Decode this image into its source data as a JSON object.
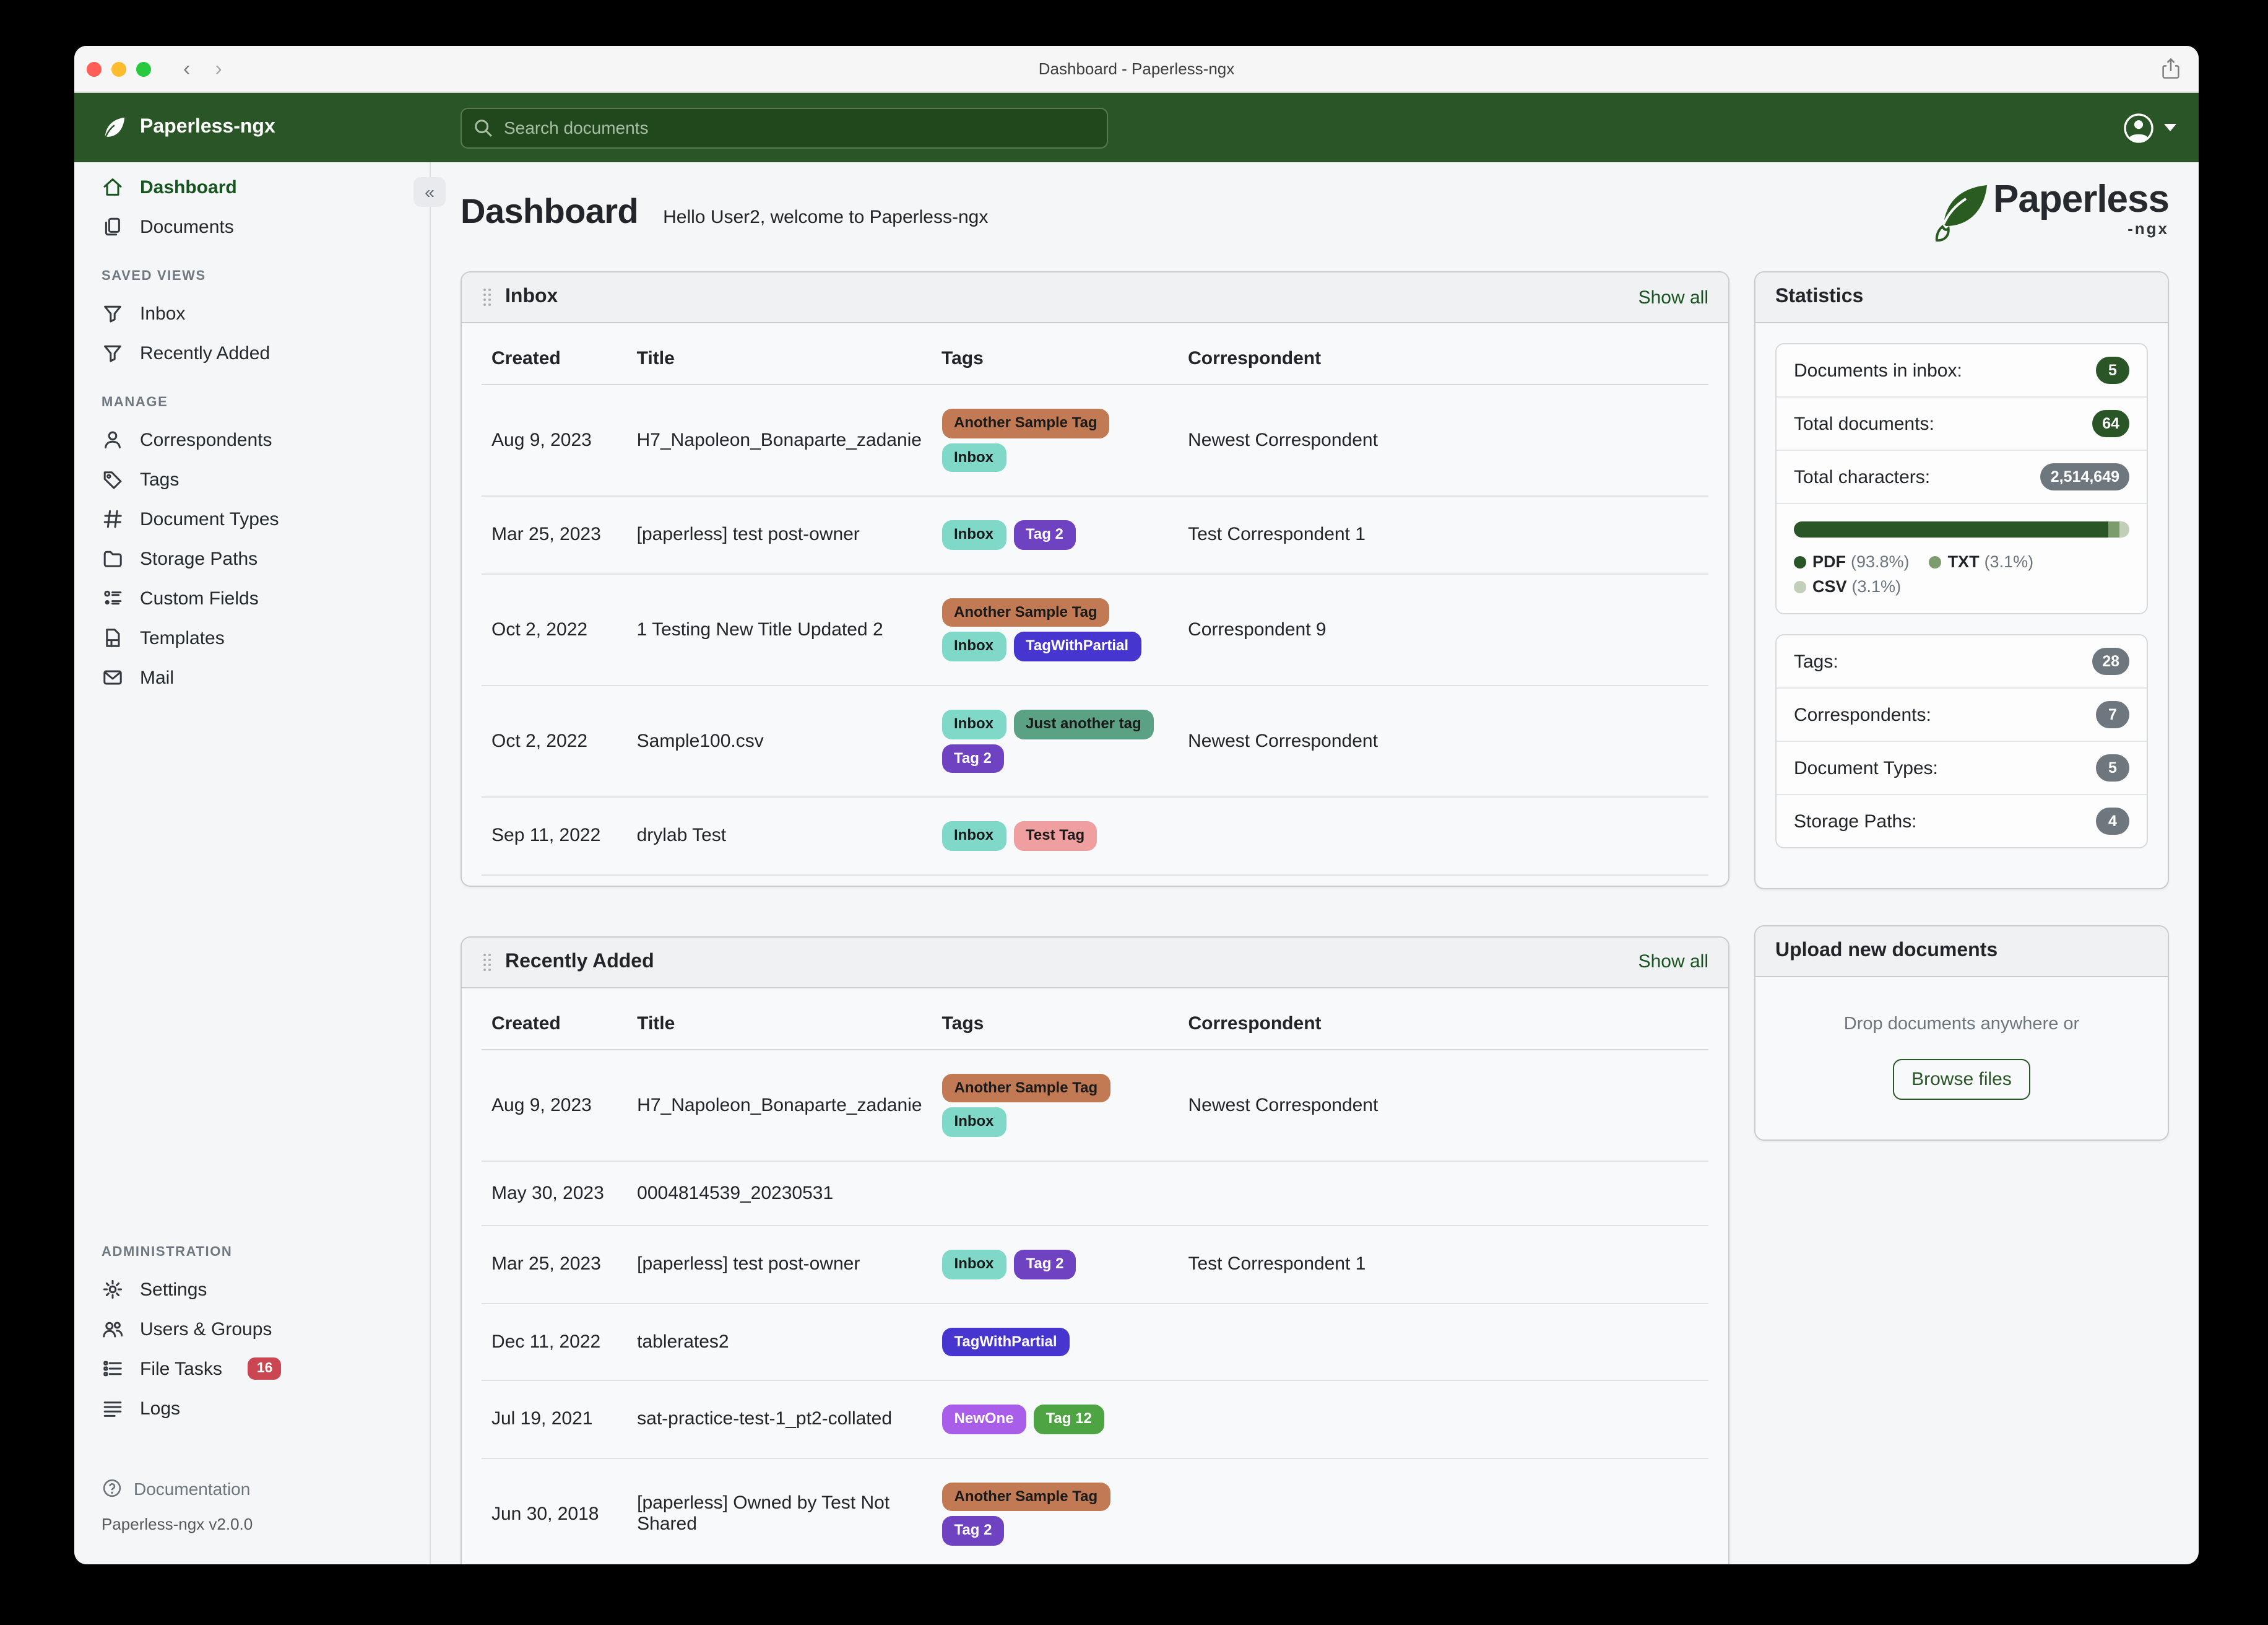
{
  "window": {
    "title": "Dashboard - Paperless-ngx"
  },
  "navbar": {
    "brand": "Paperless-ngx",
    "search_placeholder": "Search documents"
  },
  "sidebar": {
    "items": [
      {
        "label": "Dashboard",
        "icon": "home",
        "active": true
      },
      {
        "label": "Documents",
        "icon": "documents",
        "active": false
      }
    ],
    "sections": [
      {
        "title": "SAVED VIEWS",
        "items": [
          {
            "label": "Inbox",
            "icon": "filter"
          },
          {
            "label": "Recently Added",
            "icon": "filter"
          }
        ]
      },
      {
        "title": "MANAGE",
        "items": [
          {
            "label": "Correspondents",
            "icon": "person"
          },
          {
            "label": "Tags",
            "icon": "tag"
          },
          {
            "label": "Document Types",
            "icon": "hash"
          },
          {
            "label": "Storage Paths",
            "icon": "folder"
          },
          {
            "label": "Custom Fields",
            "icon": "fields"
          },
          {
            "label": "Templates",
            "icon": "template"
          },
          {
            "label": "Mail",
            "icon": "mail"
          }
        ]
      },
      {
        "title": "ADMINISTRATION",
        "items": [
          {
            "label": "Settings",
            "icon": "gear"
          },
          {
            "label": "Users & Groups",
            "icon": "users"
          },
          {
            "label": "File Tasks",
            "icon": "tasks",
            "badge": "16"
          },
          {
            "label": "Logs",
            "icon": "logs"
          }
        ]
      }
    ],
    "footer": {
      "documentation": "Documentation",
      "version": "Paperless-ngx v2.0.0"
    }
  },
  "page": {
    "heading": "Dashboard",
    "subtitle": "Hello User2, welcome to Paperless-ngx"
  },
  "logo": {
    "name": "Paperless",
    "suffix": "-ngx"
  },
  "tag_palette": {
    "Another Sample Tag": {
      "bg": "#c17a53",
      "fg": "#1a1a1a"
    },
    "Inbox": {
      "bg": "#7fd8c8",
      "fg": "#1a1a1a"
    },
    "Tag 2": {
      "bg": "#6f42c1",
      "fg": "#ffffff"
    },
    "TagWithPartial": {
      "bg": "#4636cf",
      "fg": "#ffffff"
    },
    "Just another tag": {
      "bg": "#5ba184",
      "fg": "#1a1a1a"
    },
    "Test Tag": {
      "bg": "#ef9f9f",
      "fg": "#1a1a1a"
    },
    "NewOne": {
      "bg": "#a95eea",
      "fg": "#ffffff"
    },
    "Tag 12": {
      "bg": "#4ea342",
      "fg": "#ffffff"
    }
  },
  "cards": [
    {
      "title": "Inbox",
      "show_all": "Show all",
      "columns": [
        "Created",
        "Title",
        "Tags",
        "Correspondent"
      ],
      "rows": [
        {
          "created": "Aug 9, 2023",
          "title": "H7_Napoleon_Bonaparte_zadanie",
          "tags": [
            "Another Sample Tag",
            "Inbox"
          ],
          "correspondent": "Newest Correspondent"
        },
        {
          "created": "Mar 25, 2023",
          "title": "[paperless] test post-owner",
          "tags": [
            "Inbox",
            "Tag 2"
          ],
          "correspondent": "Test Correspondent 1"
        },
        {
          "created": "Oct 2, 2022",
          "title": "1 Testing New Title Updated 2",
          "tags": [
            "Another Sample Tag",
            "Inbox",
            "TagWithPartial"
          ],
          "correspondent": "Correspondent 9"
        },
        {
          "created": "Oct 2, 2022",
          "title": "Sample100.csv",
          "tags": [
            "Inbox",
            "Just another tag",
            "Tag 2"
          ],
          "correspondent": "Newest Correspondent"
        },
        {
          "created": "Sep 11, 2022",
          "title": "drylab Test",
          "tags": [
            "Inbox",
            "Test Tag"
          ],
          "correspondent": ""
        }
      ]
    },
    {
      "title": "Recently Added",
      "show_all": "Show all",
      "columns": [
        "Created",
        "Title",
        "Tags",
        "Correspondent"
      ],
      "rows": [
        {
          "created": "Aug 9, 2023",
          "title": "H7_Napoleon_Bonaparte_zadanie",
          "tags": [
            "Another Sample Tag",
            "Inbox"
          ],
          "correspondent": "Newest Correspondent"
        },
        {
          "created": "May 30, 2023",
          "title": "0004814539_20230531",
          "tags": [],
          "correspondent": ""
        },
        {
          "created": "Mar 25, 2023",
          "title": "[paperless] test post-owner",
          "tags": [
            "Inbox",
            "Tag 2"
          ],
          "correspondent": "Test Correspondent 1"
        },
        {
          "created": "Dec 11, 2022",
          "title": "tablerates2",
          "tags": [
            "TagWithPartial"
          ],
          "correspondent": ""
        },
        {
          "created": "Jul 19, 2021",
          "title": "sat-practice-test-1_pt2-collated",
          "tags": [
            "NewOne",
            "Tag 12"
          ],
          "correspondent": ""
        },
        {
          "created": "Jun 30, 2018",
          "title": "[paperless] Owned by Test Not Shared",
          "tags": [
            "Another Sample Tag",
            "Tag 2"
          ],
          "correspondent": ""
        }
      ]
    }
  ],
  "statistics": {
    "title": "Statistics",
    "rows": [
      {
        "label": "Documents in inbox:",
        "value": "5",
        "style": "green"
      },
      {
        "label": "Total documents:",
        "value": "64",
        "style": "green"
      },
      {
        "label": "Total characters:",
        "value": "2,514,649",
        "style": "gray"
      }
    ],
    "file_type_chart": {
      "type": "bar",
      "segments": [
        {
          "label": "PDF",
          "pct": 93.8,
          "pct_text": "(93.8%)",
          "color": "#2a5527"
        },
        {
          "label": "TXT",
          "pct": 3.1,
          "pct_text": "(3.1%)",
          "color": "#7d9c6e"
        },
        {
          "label": "CSV",
          "pct": 3.1,
          "pct_text": "(3.1%)",
          "color": "#c2cfb8"
        }
      ]
    },
    "counts": [
      {
        "label": "Tags:",
        "value": "28",
        "style": "gray"
      },
      {
        "label": "Correspondents:",
        "value": "7",
        "style": "gray"
      },
      {
        "label": "Document Types:",
        "value": "5",
        "style": "gray"
      },
      {
        "label": "Storage Paths:",
        "value": "4",
        "style": "gray"
      }
    ]
  },
  "upload": {
    "title": "Upload new documents",
    "hint": "Drop documents anywhere or",
    "button": "Browse files"
  },
  "colors": {
    "navbar_green": "#2a5526",
    "link_green": "#17541f",
    "badge_green": "#2a5527",
    "badge_gray": "#6e767e",
    "file_tasks_badge_red": "#cb4653"
  }
}
